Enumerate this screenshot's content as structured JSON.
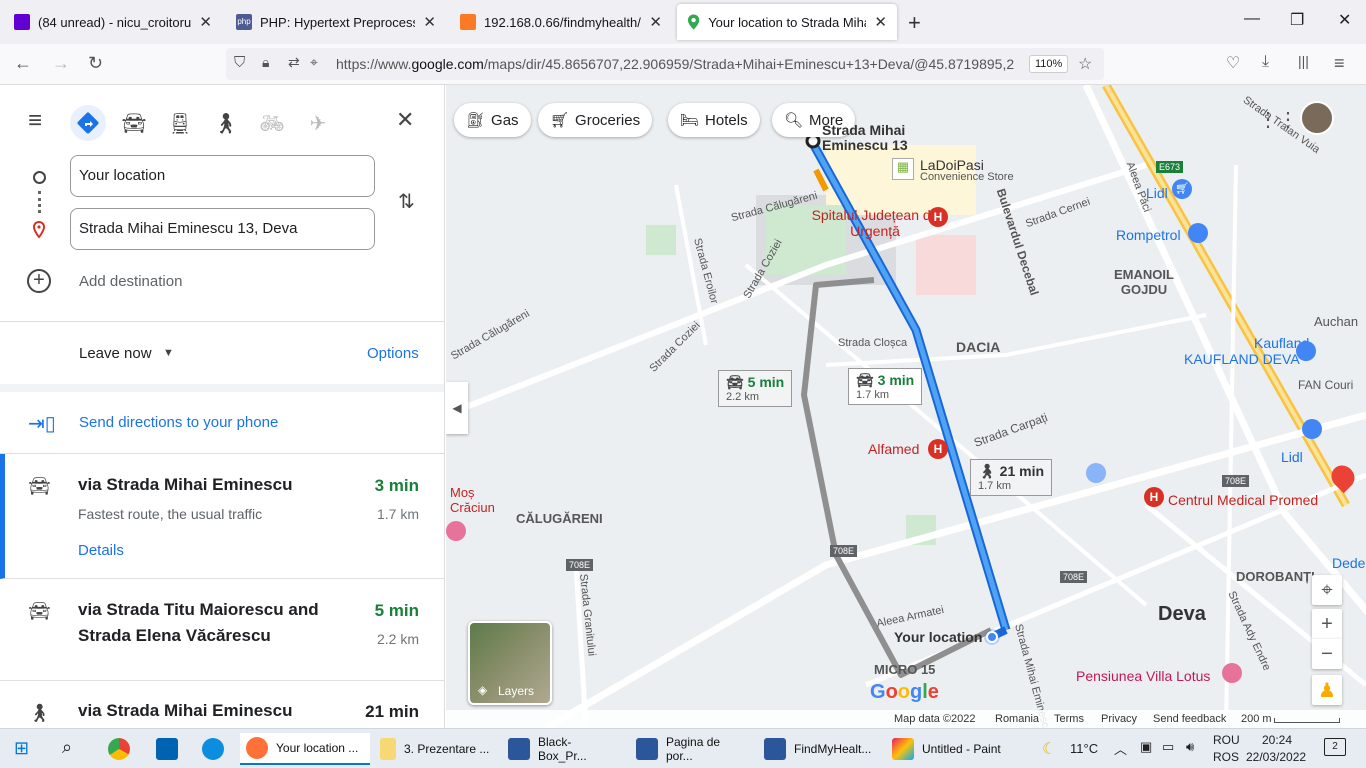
{
  "tabs": [
    {
      "label": "(84 unread) - nicu_croitoru@ya",
      "icon": "mail-icon"
    },
    {
      "label": "PHP: Hypertext Preprocessor",
      "icon": "php-icon"
    },
    {
      "label": "192.168.0.66/findmyhealth/view",
      "icon": "xampp-icon"
    },
    {
      "label": "Your location to Strada Mihai Em",
      "icon": "maps-pin-icon"
    }
  ],
  "browser": {
    "url_prefix": "https://www.",
    "url_host": "google.com",
    "url_rest": "/maps/dir/45.8656707,22.906959/Strada+Mihai+Eminescu+13+Deva/@45.8719895,2",
    "zoom": "110%"
  },
  "panel": {
    "origin_value": "Your location",
    "destination_value": "Strada Mihai Eminescu 13, Deva",
    "add_destination": "Add destination",
    "leave_now": "Leave now",
    "options": "Options",
    "send_directions": "Send directions to your phone",
    "routes": [
      {
        "via": "via Strada Mihai Eminescu",
        "time": "3 min",
        "dist": "1.7 km",
        "note": "Fastest route, the usual traffic",
        "details": "Details"
      },
      {
        "via": "via Strada Titu Maiorescu and Strada Elena Văcărescu",
        "time": "5 min",
        "dist": "2.2 km"
      },
      {
        "via": "via Strada Mihai Eminescu",
        "time": "21 min"
      }
    ]
  },
  "map": {
    "chips": [
      "Gas",
      "Groceries",
      "Hotels",
      "More"
    ],
    "bubbles": [
      {
        "time": "3 min",
        "dist": "1.7 km"
      },
      {
        "time": "5 min",
        "dist": "2.2 km"
      },
      {
        "time": "21 min",
        "dist": "1.7 km"
      }
    ],
    "labels": {
      "dest": "Strada Mihai Eminescu 13",
      "ladoipasi": "LaDoiPasi",
      "ladoipasi_sub": "Convenience Store",
      "spital": "Spitalul Județean de Urgență",
      "alfamed": "Alfamed",
      "mos": "Moș Crăciun",
      "centrul": "Centrul Medical Promed",
      "pensiunea": "Pensiunea Villa Lotus",
      "lidl1": "Lidl",
      "lidl2": "Lidl",
      "rompetrol": "Rompetrol",
      "kaufland": "KAUFLAND DEVA",
      "kaufland_top": "Kaufland",
      "fan": "FAN Couri",
      "auchan": "Auchan",
      "dacia": "DACIA",
      "emanoil": "EMANOIL GOJDU",
      "calugareni": "CĂLUGĂRENI",
      "dorobanti": "DOROBANȚI",
      "deva": "Deva",
      "micro15": "MICRO 15",
      "your_location": "Your location",
      "dede": "Dede",
      "s_closca": "Strada Cloșca",
      "s_carpati": "Strada Carpați",
      "s_calugareni": "Strada Călugăreni",
      "s_eroilor": "Strada Eroilor",
      "s_cozia": "Strada Coziei",
      "s_armatei": "Aleea Armatei",
      "s_decebal": "Bulevardul Decebal",
      "s_granitului": "Strada Granitului",
      "s_cernei": "Strada Cernei",
      "s_paci": "Aleea Păci",
      "s_ady": "Strada Ady Endre",
      "s_eminescu": "Strada Mihai Eminescu",
      "s_traian": "Strada Traian Vuia",
      "r708_1": "708E",
      "r708_2": "708E",
      "r708_3": "708E",
      "r708_4": "708E",
      "e673": "E673"
    },
    "layers": "Layers",
    "footer": {
      "data": "Map data ©2022",
      "country": "Romania",
      "terms": "Terms",
      "privacy": "Privacy",
      "feedback": "Send feedback",
      "scale": "200 m"
    }
  },
  "taskbar": {
    "items": [
      "Your location ...",
      "3. Prezentare ...",
      "Black-Box_Pr...",
      "Pagina de por...",
      "FindMyHealt...",
      "Untitled - Paint"
    ],
    "temp": "11°C",
    "lang1": "ROU",
    "lang2": "ROS",
    "time": "20:24",
    "date": "22/03/2022",
    "notif": "2"
  },
  "colors": {
    "route": "#1a73e8",
    "alt_route": "#9aa0a6",
    "accent": "#1a73e8",
    "green": "#188038"
  }
}
